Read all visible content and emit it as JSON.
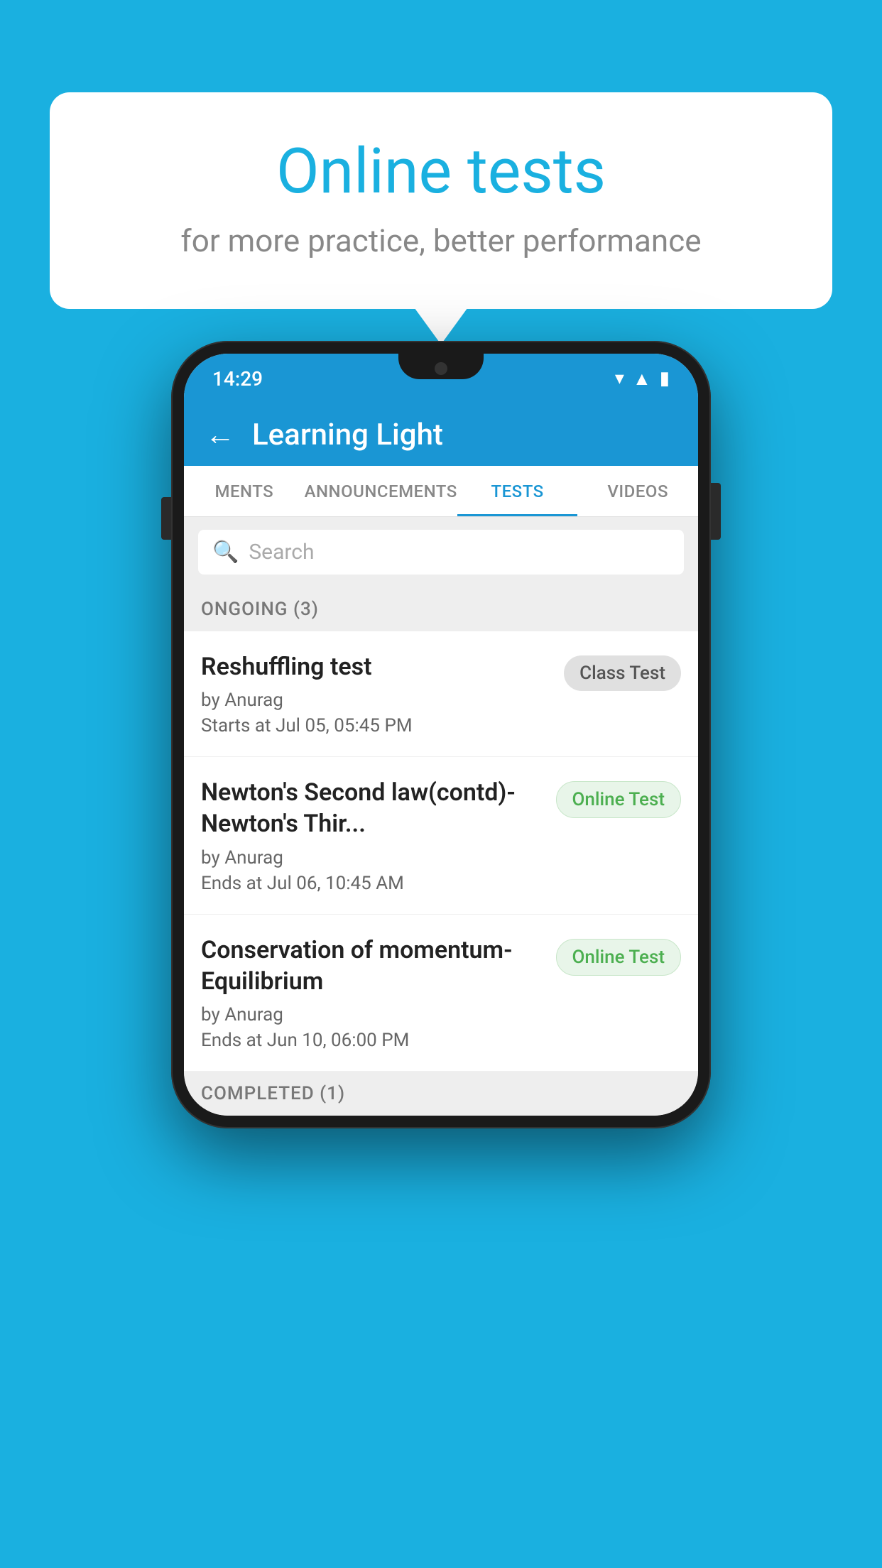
{
  "background": {
    "color": "#1ab0e0"
  },
  "speech_bubble": {
    "title": "Online tests",
    "subtitle": "for more practice, better performance"
  },
  "phone": {
    "status_bar": {
      "time": "14:29",
      "icons": [
        "wifi",
        "signal",
        "battery"
      ]
    },
    "app_header": {
      "back_label": "←",
      "title": "Learning Light"
    },
    "tabs": [
      {
        "label": "MENTS",
        "active": false
      },
      {
        "label": "ANNOUNCEMENTS",
        "active": false
      },
      {
        "label": "TESTS",
        "active": true
      },
      {
        "label": "VIDEOS",
        "active": false
      }
    ],
    "search": {
      "placeholder": "Search"
    },
    "ongoing_section": {
      "label": "ONGOING (3)"
    },
    "test_items": [
      {
        "name": "Reshuffling test",
        "author": "by Anurag",
        "time": "Starts at  Jul 05, 05:45 PM",
        "badge": "Class Test",
        "badge_type": "class"
      },
      {
        "name": "Newton's Second law(contd)-Newton's Thir...",
        "author": "by Anurag",
        "time": "Ends at  Jul 06, 10:45 AM",
        "badge": "Online Test",
        "badge_type": "online"
      },
      {
        "name": "Conservation of momentum-Equilibrium",
        "author": "by Anurag",
        "time": "Ends at  Jun 10, 06:00 PM",
        "badge": "Online Test",
        "badge_type": "online"
      }
    ],
    "completed_section": {
      "label": "COMPLETED (1)"
    }
  }
}
